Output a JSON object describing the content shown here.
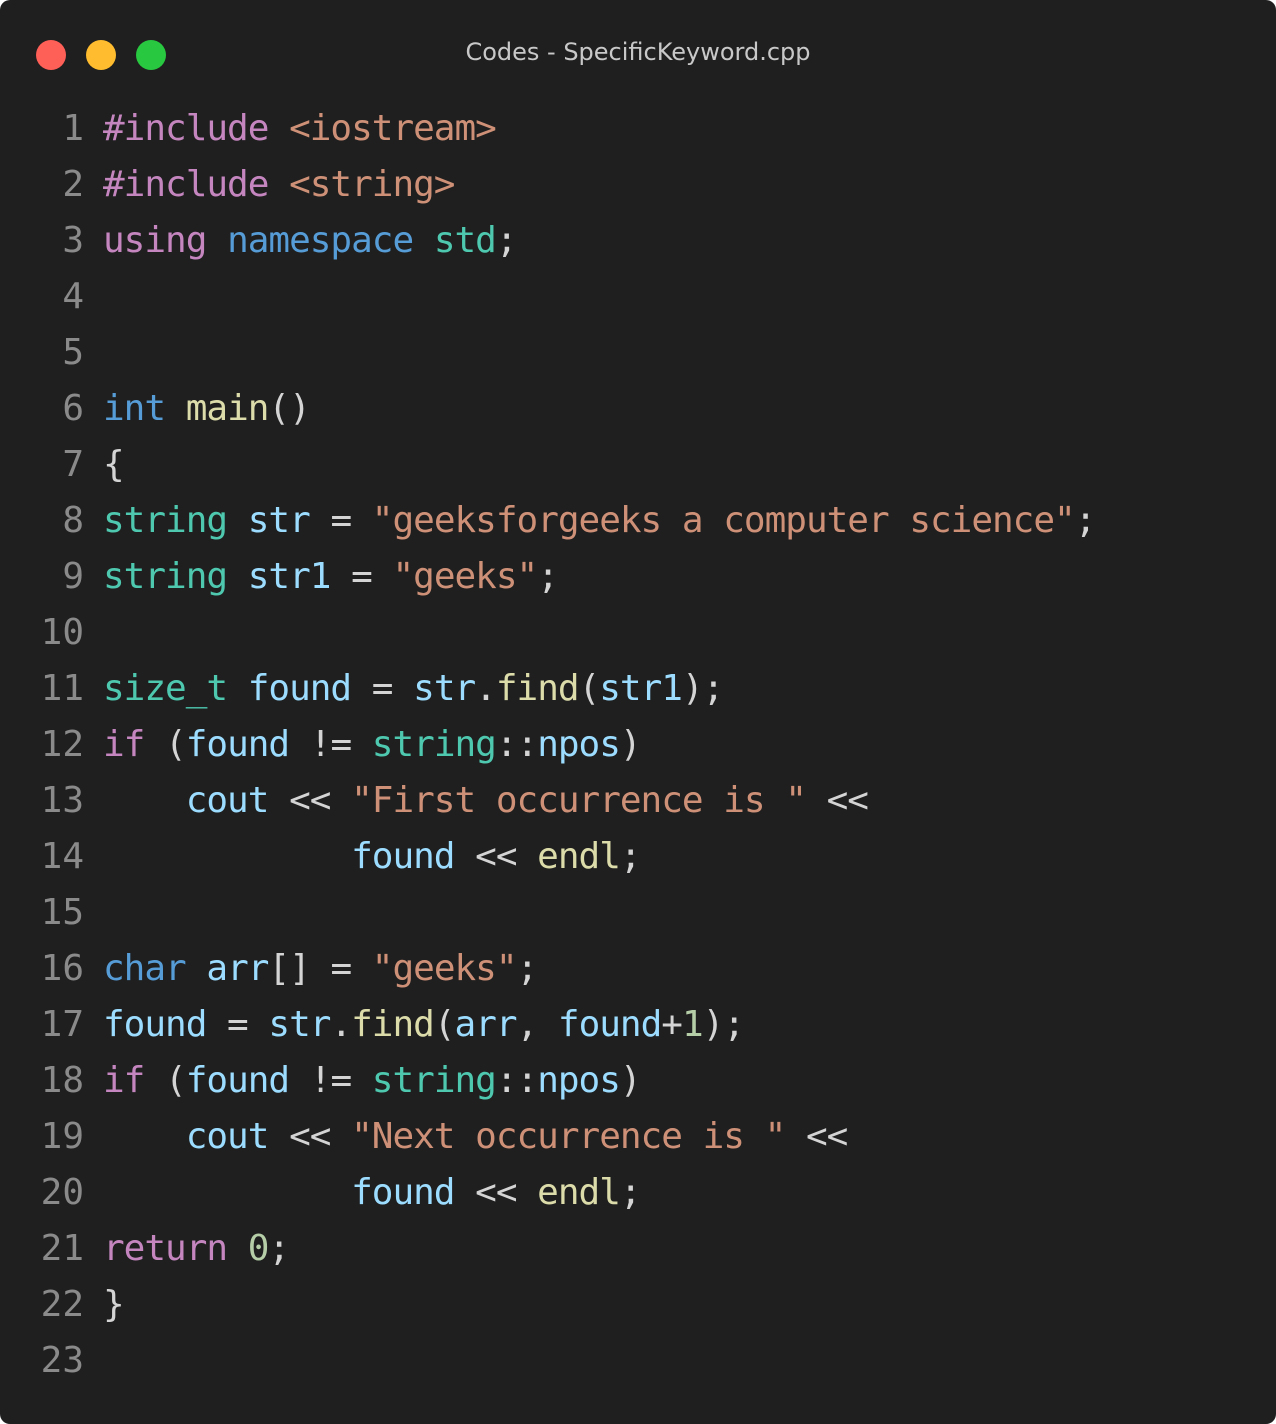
{
  "window": {
    "title": "Codes - SpecificKeyword.cpp"
  },
  "colors": {
    "background": "#1f1f1f",
    "keyword": "#c586c0",
    "type": "#569cd6",
    "class": "#4ec9b0",
    "string": "#ce9178",
    "variable": "#9cdcfe",
    "function": "#dcdcaa",
    "number": "#b5cea8",
    "plain": "#d4d4d4",
    "line_number": "#8a8a8a"
  },
  "code_lines": [
    {
      "n": "1",
      "tokens": [
        [
          "#include",
          "kw"
        ],
        [
          " ",
          "plain"
        ],
        [
          "<iostream>",
          "str"
        ]
      ]
    },
    {
      "n": "2",
      "tokens": [
        [
          "#include",
          "kw"
        ],
        [
          " ",
          "plain"
        ],
        [
          "<string>",
          "str"
        ]
      ]
    },
    {
      "n": "3",
      "tokens": [
        [
          "using",
          "kw"
        ],
        [
          " ",
          "plain"
        ],
        [
          "namespace",
          "type"
        ],
        [
          " ",
          "plain"
        ],
        [
          "std",
          "cls"
        ],
        [
          ";",
          "plain"
        ]
      ]
    },
    {
      "n": "4",
      "tokens": []
    },
    {
      "n": "5",
      "tokens": []
    },
    {
      "n": "6",
      "tokens": [
        [
          "int",
          "type"
        ],
        [
          " ",
          "plain"
        ],
        [
          "main",
          "fn"
        ],
        [
          "()",
          "plain"
        ]
      ]
    },
    {
      "n": "7",
      "tokens": [
        [
          "{",
          "plain"
        ]
      ]
    },
    {
      "n": "8",
      "tokens": [
        [
          "string",
          "cls"
        ],
        [
          " ",
          "plain"
        ],
        [
          "str",
          "var"
        ],
        [
          " = ",
          "plain"
        ],
        [
          "\"geeksforgeeks a computer science\"",
          "str"
        ],
        [
          ";",
          "plain"
        ]
      ]
    },
    {
      "n": "9",
      "tokens": [
        [
          "string",
          "cls"
        ],
        [
          " ",
          "plain"
        ],
        [
          "str1",
          "var"
        ],
        [
          " = ",
          "plain"
        ],
        [
          "\"geeks\"",
          "str"
        ],
        [
          ";",
          "plain"
        ]
      ]
    },
    {
      "n": "10",
      "tokens": []
    },
    {
      "n": "11",
      "tokens": [
        [
          "size_t",
          "cls"
        ],
        [
          " ",
          "plain"
        ],
        [
          "found",
          "var"
        ],
        [
          " = ",
          "plain"
        ],
        [
          "str",
          "var"
        ],
        [
          ".",
          "plain"
        ],
        [
          "find",
          "fn"
        ],
        [
          "(",
          "plain"
        ],
        [
          "str1",
          "var"
        ],
        [
          ");",
          "plain"
        ]
      ]
    },
    {
      "n": "12",
      "tokens": [
        [
          "if",
          "kw"
        ],
        [
          " (",
          "plain"
        ],
        [
          "found",
          "var"
        ],
        [
          " != ",
          "plain"
        ],
        [
          "string",
          "cls"
        ],
        [
          "::",
          "plain"
        ],
        [
          "npos",
          "var"
        ],
        [
          ")",
          "plain"
        ]
      ]
    },
    {
      "n": "13",
      "tokens": [
        [
          "    ",
          "plain"
        ],
        [
          "cout",
          "var"
        ],
        [
          " << ",
          "plain"
        ],
        [
          "\"First occurrence is \"",
          "str"
        ],
        [
          " <<",
          "plain"
        ]
      ]
    },
    {
      "n": "14",
      "tokens": [
        [
          "            ",
          "plain"
        ],
        [
          "found",
          "var"
        ],
        [
          " << ",
          "plain"
        ],
        [
          "endl",
          "fn"
        ],
        [
          ";",
          "plain"
        ]
      ]
    },
    {
      "n": "15",
      "tokens": []
    },
    {
      "n": "16",
      "tokens": [
        [
          "char",
          "type"
        ],
        [
          " ",
          "plain"
        ],
        [
          "arr",
          "var"
        ],
        [
          "[] = ",
          "plain"
        ],
        [
          "\"geeks\"",
          "str"
        ],
        [
          ";",
          "plain"
        ]
      ]
    },
    {
      "n": "17",
      "tokens": [
        [
          "found",
          "var"
        ],
        [
          " = ",
          "plain"
        ],
        [
          "str",
          "var"
        ],
        [
          ".",
          "plain"
        ],
        [
          "find",
          "fn"
        ],
        [
          "(",
          "plain"
        ],
        [
          "arr",
          "var"
        ],
        [
          ", ",
          "plain"
        ],
        [
          "found",
          "var"
        ],
        [
          "+",
          "plain"
        ],
        [
          "1",
          "num"
        ],
        [
          ");",
          "plain"
        ]
      ]
    },
    {
      "n": "18",
      "tokens": [
        [
          "if",
          "kw"
        ],
        [
          " (",
          "plain"
        ],
        [
          "found",
          "var"
        ],
        [
          " != ",
          "plain"
        ],
        [
          "string",
          "cls"
        ],
        [
          "::",
          "plain"
        ],
        [
          "npos",
          "var"
        ],
        [
          ")",
          "plain"
        ]
      ]
    },
    {
      "n": "19",
      "tokens": [
        [
          "    ",
          "plain"
        ],
        [
          "cout",
          "var"
        ],
        [
          " << ",
          "plain"
        ],
        [
          "\"Next occurrence is \"",
          "str"
        ],
        [
          " <<",
          "plain"
        ]
      ]
    },
    {
      "n": "20",
      "tokens": [
        [
          "            ",
          "plain"
        ],
        [
          "found",
          "var"
        ],
        [
          " << ",
          "plain"
        ],
        [
          "endl",
          "fn"
        ],
        [
          ";",
          "plain"
        ]
      ]
    },
    {
      "n": "21",
      "tokens": [
        [
          "return",
          "kw"
        ],
        [
          " ",
          "plain"
        ],
        [
          "0",
          "num"
        ],
        [
          ";",
          "plain"
        ]
      ]
    },
    {
      "n": "22",
      "tokens": [
        [
          "}",
          "plain"
        ]
      ]
    },
    {
      "n": "23",
      "tokens": []
    }
  ]
}
